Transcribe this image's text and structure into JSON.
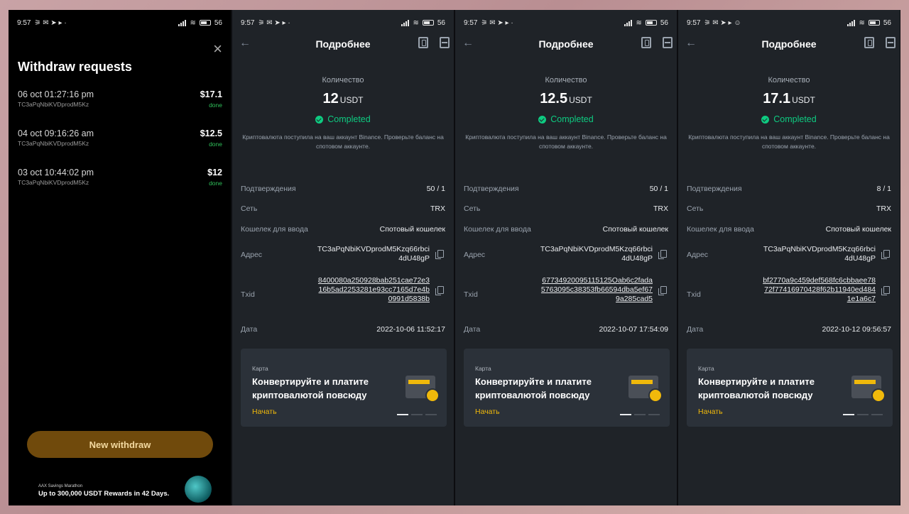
{
  "status_bar": [
    {
      "time": "9:57",
      "battery": "56"
    },
    {
      "time": "9:57",
      "battery": "56"
    },
    {
      "time": "9:57",
      "battery": "56"
    },
    {
      "time": "9:57",
      "battery": "56"
    }
  ],
  "withdraw_panel": {
    "title": "Withdraw requests",
    "close_icon": "×",
    "items": [
      {
        "date": "06 oct 01:27:16 pm",
        "address": "TC3aPqNbiKVDprodM5Kz",
        "amount": "$17.1",
        "status": "done"
      },
      {
        "date": "04 oct 09:16:26 am",
        "address": "TC3aPqNbiKVDprodM5Kz",
        "amount": "$12.5",
        "status": "done"
      },
      {
        "date": "03 oct 10:44:02 pm",
        "address": "TC3aPqNbiKVDprodM5Kz",
        "amount": "$12",
        "status": "done"
      }
    ],
    "new_button": "New withdraw",
    "promo_small": "AAX Savings Marathon",
    "promo_big": "Up to 300,000 USDT Rewards in 42 Days."
  },
  "detail_common": {
    "header_title": "Подробнее",
    "back_icon": "←",
    "qty_label": "Количество",
    "unit": "USDT",
    "status": "Completed",
    "note": "Криптовалюта поступила на ваш аккаунт Binance. Проверьте баланс на спотовом аккаунте.",
    "labels": {
      "confirmations": "Подтверждения",
      "network": "Сеть",
      "wallet": "Кошелек для ввода",
      "address": "Адрес",
      "txid": "Txid",
      "date": "Дата"
    },
    "card_kicker": "Карта",
    "card_title": "Конвертируйте и платите криптовалютой повсюду",
    "card_cta": "Начать"
  },
  "details": [
    {
      "amount": "12",
      "confirmations": "50 / 1",
      "network": "TRX",
      "wallet": "Спотовый кошелек",
      "address": "TC3aPqNbiKVDprodM5Kzq66rbci4dU48gP",
      "txid": "8400080a250928bab251cae72e316b5ad2253281e93cc7165d7e4b0991d5838b",
      "date": "2022-10-06 11:52:17"
    },
    {
      "amount": "12.5",
      "confirmations": "50 / 1",
      "network": "TRX",
      "wallet": "Спотовый кошелек",
      "address": "TC3aPqNbiKVDprodM5Kzq66rbci4dU48gP",
      "txid": "67734920095115125Oab6c2fada5763095c38353fb66594dba5ef679a285cad5",
      "date": "2022-10-07 17:54:09"
    },
    {
      "amount": "17.1",
      "confirmations": "8 / 1",
      "network": "TRX",
      "wallet": "Спотовый кошелек",
      "address": "TC3aPqNbiKVDprodM5Kzq66rbci4dU48gP",
      "txid": "bf2770a9c459def568fc6cbbaee7872f77416970428f62b11940ed4841e1a6c7",
      "date": "2022-10-12 09:56:57"
    }
  ]
}
